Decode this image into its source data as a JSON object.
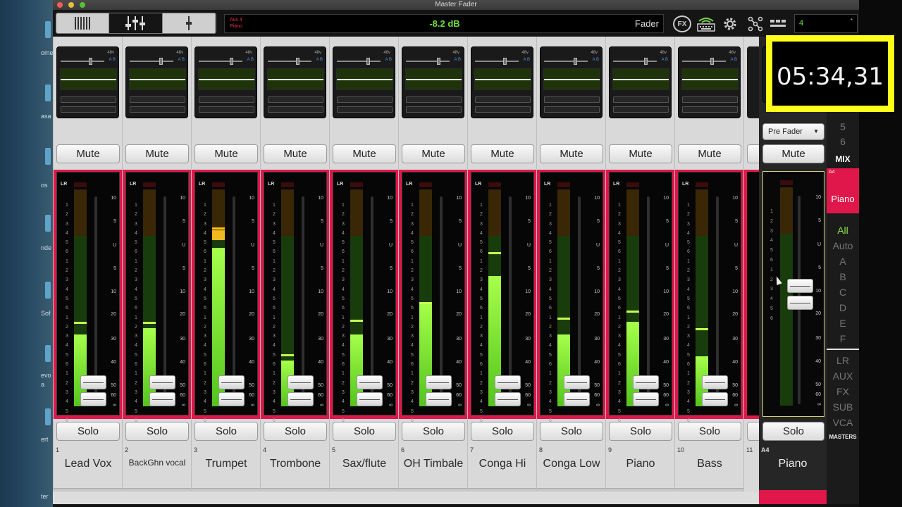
{
  "window": {
    "title": "Master Fader"
  },
  "display": {
    "channel_top": "Aux 4",
    "channel_bottom": "Piano",
    "level": "-8.2 dB",
    "mode": "Fader"
  },
  "toolbar": {
    "fx_label": "FX",
    "scene_value": "4",
    "scene_marker": "*"
  },
  "channels": [
    {
      "num": "1",
      "name": "Lead Vox",
      "mute": "Mute",
      "solo": "Solo",
      "level": 0.33,
      "peak": 0.39,
      "fader": 0.07
    },
    {
      "num": "2",
      "name": "BackGhn vocal",
      "mute": "Mute",
      "solo": "Solo",
      "level": 0.36,
      "peak": 0.39,
      "fader": 0.07
    },
    {
      "num": "3",
      "name": "Trumpet",
      "mute": "Mute",
      "solo": "Solo",
      "level": 0.73,
      "peak": 0.78,
      "fader": 0.07,
      "clip": true
    },
    {
      "num": "4",
      "name": "Trombone",
      "mute": "Mute",
      "solo": "Solo",
      "level": 0.21,
      "peak": 0.24,
      "fader": 0.07
    },
    {
      "num": "5",
      "name": "Sax/flute",
      "mute": "Mute",
      "solo": "Solo",
      "level": 0.33,
      "peak": 0.4,
      "fader": 0.07
    },
    {
      "num": "6",
      "name": "OH Timbale",
      "mute": "Mute",
      "solo": "Solo",
      "level": 0.48,
      "peak": 0.48,
      "fader": 0.07
    },
    {
      "num": "7",
      "name": "Conga Hi",
      "mute": "Mute",
      "solo": "Solo",
      "level": 0.6,
      "peak": 0.71,
      "fader": 0.07
    },
    {
      "num": "8",
      "name": "Conga Low",
      "mute": "Mute",
      "solo": "Solo",
      "level": 0.33,
      "peak": 0.41,
      "fader": 0.07
    },
    {
      "num": "9",
      "name": "Piano",
      "mute": "Mute",
      "solo": "Solo",
      "level": 0.39,
      "peak": 0.44,
      "fader": 0.07
    },
    {
      "num": "10",
      "name": "Bass",
      "mute": "Mute",
      "solo": "Solo",
      "level": 0.23,
      "peak": 0.36,
      "fader": 0.07
    }
  ],
  "partial_channel": {
    "num": "11"
  },
  "master": {
    "code": "A4",
    "name": "Piano",
    "mute": "Mute",
    "solo": "Solo",
    "tap": "Pre Fader",
    "fader": 0.53
  },
  "meter_scale": [
    "1",
    "2",
    "3",
    "4",
    "5",
    "6",
    "1",
    "2",
    "3",
    "4",
    "5",
    "6",
    "1",
    "2",
    "3",
    "4",
    "5",
    "6",
    "1",
    "2",
    "3",
    "4",
    "5",
    "6"
  ],
  "fader_scale": [
    "10",
    "5",
    "U",
    "5",
    "10",
    "20",
    "30",
    "40",
    "50",
    "60",
    "∞"
  ],
  "side_panel": {
    "hidden_numbers": [
      "5",
      "6"
    ],
    "mix_label": "MIX",
    "active": {
      "code": "A4",
      "name": "Piano"
    },
    "filters": [
      "All",
      "Auto",
      "A",
      "B",
      "C",
      "D",
      "E",
      "F"
    ],
    "types": [
      "LR",
      "AUX",
      "FX",
      "SUB",
      "VCA"
    ],
    "masters_label": "MASTERS"
  },
  "timer": "05:34,31",
  "desktop_fragments": [
    "ome",
    "asa",
    "os",
    "nde",
    "Sof",
    "evo",
    "a",
    "ert",
    "ter"
  ],
  "colors": {
    "accent": "#e0174a",
    "meter_green": "#7cf03a",
    "display_green": "#6ee040",
    "timer_frame": "#ffff1a"
  }
}
